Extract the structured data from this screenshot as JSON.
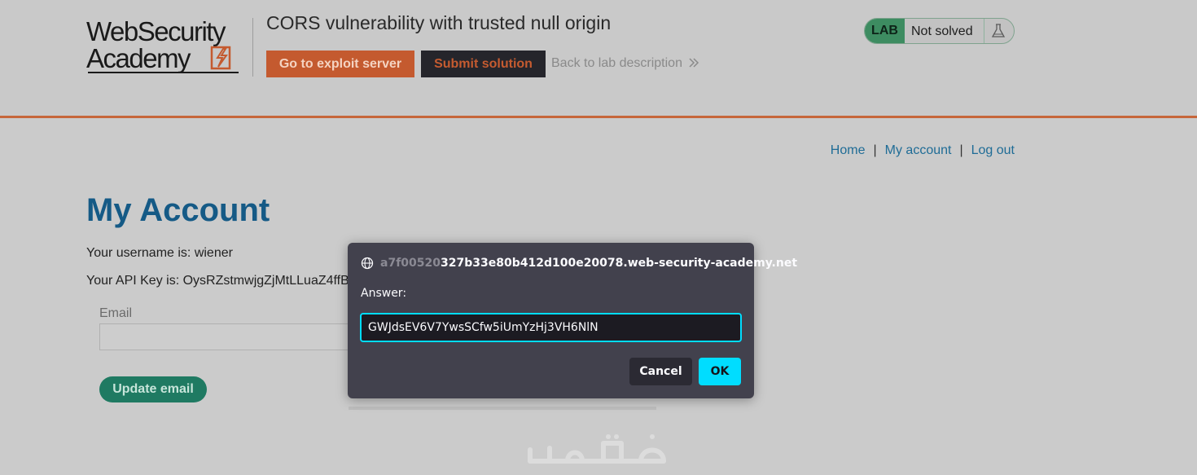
{
  "header": {
    "logo_line1": "WebSecurity",
    "logo_line2": "Academy",
    "lab_title": "CORS vulnerability with trusted null origin",
    "exploit_button": "Go to exploit server",
    "submit_button": "Submit solution",
    "back_link": "Back to lab description",
    "lab_badge": "LAB",
    "lab_status": "Not solved"
  },
  "nav": {
    "home": "Home",
    "separator": "|",
    "my_account": "My account",
    "log_out": "Log out"
  },
  "main": {
    "title": "My Account",
    "username_line": "Your username is: wiener",
    "api_key_line": "Your API Key is: OysRZstmwjgZjMtLLuaZ4ffB",
    "email_label": "Email",
    "email_value": "",
    "update_button": "Update email"
  },
  "dialog": {
    "origin_faded": "a7f00520",
    "origin_rest": "327b33e80b412d100e20078.web-security-academy.net",
    "answer_label": "Answer:",
    "answer_value": "GWJdsEV6V7YwsSCfw5iUmYzHj3VH6NlN",
    "cancel_label": "Cancel",
    "ok_label": "OK"
  },
  "colors": {
    "accent_orange": "#c45a2f",
    "dialog_accent": "#00ddff",
    "link_blue": "#1f6c96",
    "lab_green": "#3d8c61"
  }
}
